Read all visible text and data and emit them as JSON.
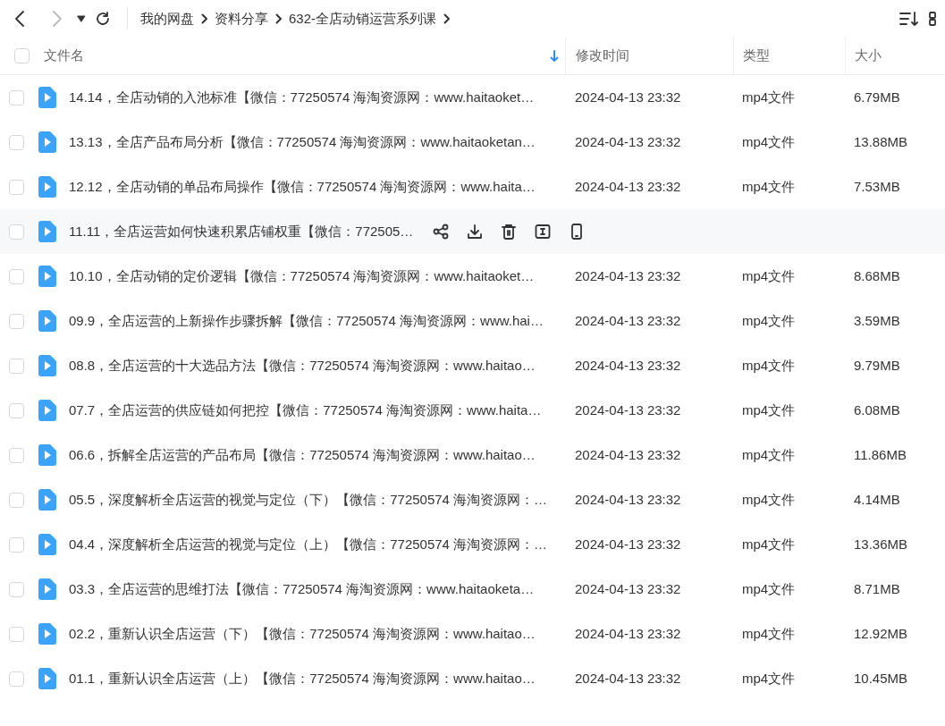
{
  "breadcrumb": [
    {
      "label": "我的网盘"
    },
    {
      "label": "资料分享"
    },
    {
      "label": "632-全店动销运营系列课"
    }
  ],
  "header": {
    "checked": false,
    "columns": [
      "文件名",
      "修改时间",
      "类型",
      "大小"
    ]
  },
  "rows": [
    {
      "name": "14.14，全店动销的入池标准【微信：77250574 海淘资源网：www.haitaoket…",
      "modified": "2024-04-13 23:32",
      "type": "mp4文件",
      "size": "6.79MB",
      "checked": false,
      "hovered": false
    },
    {
      "name": "13.13，全店产品布局分析【微信：77250574 海淘资源网：www.haitaoketan…",
      "modified": "2024-04-13 23:32",
      "type": "mp4文件",
      "size": "13.88MB",
      "checked": false,
      "hovered": false
    },
    {
      "name": "12.12，全店动销的单品布局操作【微信：77250574 海淘资源网：www.haita…",
      "modified": "2024-04-13 23:32",
      "type": "mp4文件",
      "size": "7.53MB",
      "checked": false,
      "hovered": false
    },
    {
      "name": "11.11，全店运营如何快速积累店铺权重【微信：772505…",
      "checked": false,
      "hovered": true
    },
    {
      "name": "10.10，全店动销的定价逻辑【微信：77250574 海淘资源网：www.haitaoket…",
      "modified": "2024-04-13 23:32",
      "type": "mp4文件",
      "size": "8.68MB",
      "checked": false,
      "hovered": false
    },
    {
      "name": "09.9，全店运营的上新操作步骤拆解【微信：77250574 海淘资源网：www.hai…",
      "modified": "2024-04-13 23:32",
      "type": "mp4文件",
      "size": "3.59MB",
      "checked": false,
      "hovered": false
    },
    {
      "name": "08.8，全店运营的十大选品方法【微信：77250574 海淘资源网：www.haitao…",
      "modified": "2024-04-13 23:32",
      "type": "mp4文件",
      "size": "9.79MB",
      "checked": false,
      "hovered": false
    },
    {
      "name": "07.7，全店运营的供应链如何把控【微信：77250574 海淘资源网：www.haita…",
      "modified": "2024-04-13 23:32",
      "type": "mp4文件",
      "size": "6.08MB",
      "checked": false,
      "hovered": false
    },
    {
      "name": "06.6，拆解全店运营的产品布局【微信：77250574 海淘资源网：www.haitao…",
      "modified": "2024-04-13 23:32",
      "type": "mp4文件",
      "size": "11.86MB",
      "checked": false,
      "hovered": false
    },
    {
      "name": "05.5，深度解析全店运营的视觉与定位（下）【微信：77250574 海淘资源网：…",
      "modified": "2024-04-13 23:32",
      "type": "mp4文件",
      "size": "4.14MB",
      "checked": false,
      "hovered": false
    },
    {
      "name": "04.4，深度解析全店运营的视觉与定位（上）【微信：77250574 海淘资源网：…",
      "modified": "2024-04-13 23:32",
      "type": "mp4文件",
      "size": "13.36MB",
      "checked": false,
      "hovered": false
    },
    {
      "name": "03.3，全店运营的思维打法【微信：77250574 海淘资源网：www.haitaoketa…",
      "modified": "2024-04-13 23:32",
      "type": "mp4文件",
      "size": "8.71MB",
      "checked": false,
      "hovered": false
    },
    {
      "name": "02.2，重新认识全店运营（下）【微信：77250574 海淘资源网：www.haitao…",
      "modified": "2024-04-13 23:32",
      "type": "mp4文件",
      "size": "12.92MB",
      "checked": false,
      "hovered": false
    },
    {
      "name": "01.1，重新认识全店运营（上）【微信：77250574 海淘资源网：www.haitao…",
      "modified": "2024-04-13 23:32",
      "type": "mp4文件",
      "size": "10.45MB",
      "checked": false,
      "hovered": false
    }
  ]
}
